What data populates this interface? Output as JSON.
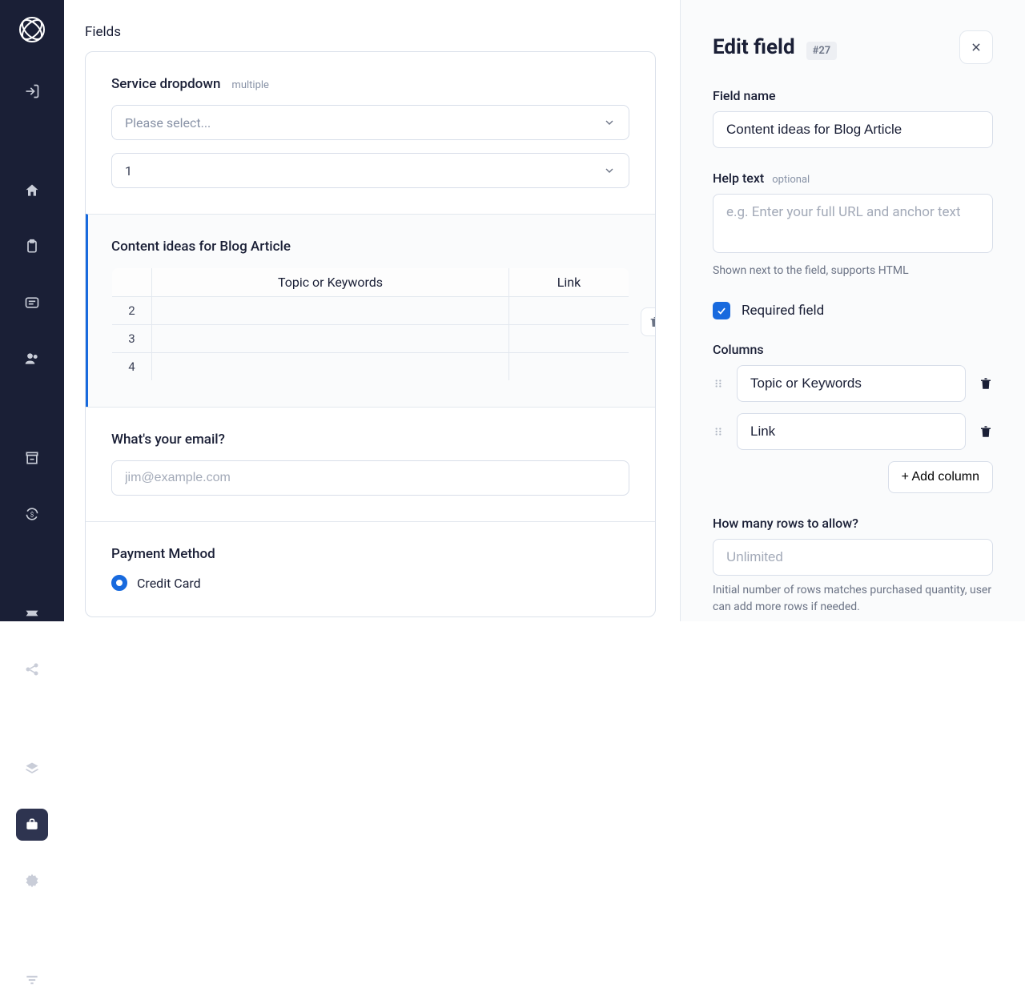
{
  "sidebar": {
    "items": [
      {
        "name": "login-icon"
      },
      {
        "name": "home-icon"
      },
      {
        "name": "clipboard-icon"
      },
      {
        "name": "message-icon"
      },
      {
        "name": "users-icon"
      },
      {
        "name": "archive-icon"
      },
      {
        "name": "refresh-dollar-icon"
      },
      {
        "name": "ticket-icon"
      },
      {
        "name": "share-icon"
      },
      {
        "name": "layers-icon"
      },
      {
        "name": "briefcase-icon",
        "active": true
      },
      {
        "name": "gear-icon"
      },
      {
        "name": "filter-icon"
      }
    ]
  },
  "preview": {
    "section_title": "Fields",
    "field1": {
      "label": "Service dropdown",
      "tag": "multiple",
      "placeholder": "Please select...",
      "second_value": "1"
    },
    "field2": {
      "label": "Content ideas for Blog Article",
      "columns": [
        "Topic or Keywords",
        "Link"
      ],
      "row_numbers": [
        "2",
        "3",
        "4"
      ]
    },
    "field3": {
      "label": "What's your email?",
      "placeholder": "jim@example.com"
    },
    "field4": {
      "label": "Payment Method",
      "option": "Credit Card"
    }
  },
  "editor": {
    "title": "Edit field",
    "badge": "#27",
    "field_name_label": "Field name",
    "field_name_value": "Content ideas for Blog Article",
    "help_text_label": "Help text",
    "help_text_optional": "optional",
    "help_text_placeholder": "e.g. Enter your full URL and anchor text",
    "help_text_hint": "Shown next to the field, supports HTML",
    "required_label": "Required field",
    "columns_label": "Columns",
    "columns": [
      "Topic or Keywords",
      "Link"
    ],
    "add_column_label": "+ Add column",
    "rows_label": "How many rows to allow?",
    "rows_placeholder": "Unlimited",
    "rows_hint": "Initial number of rows matches purchased quantity, user can add more rows if needed."
  }
}
